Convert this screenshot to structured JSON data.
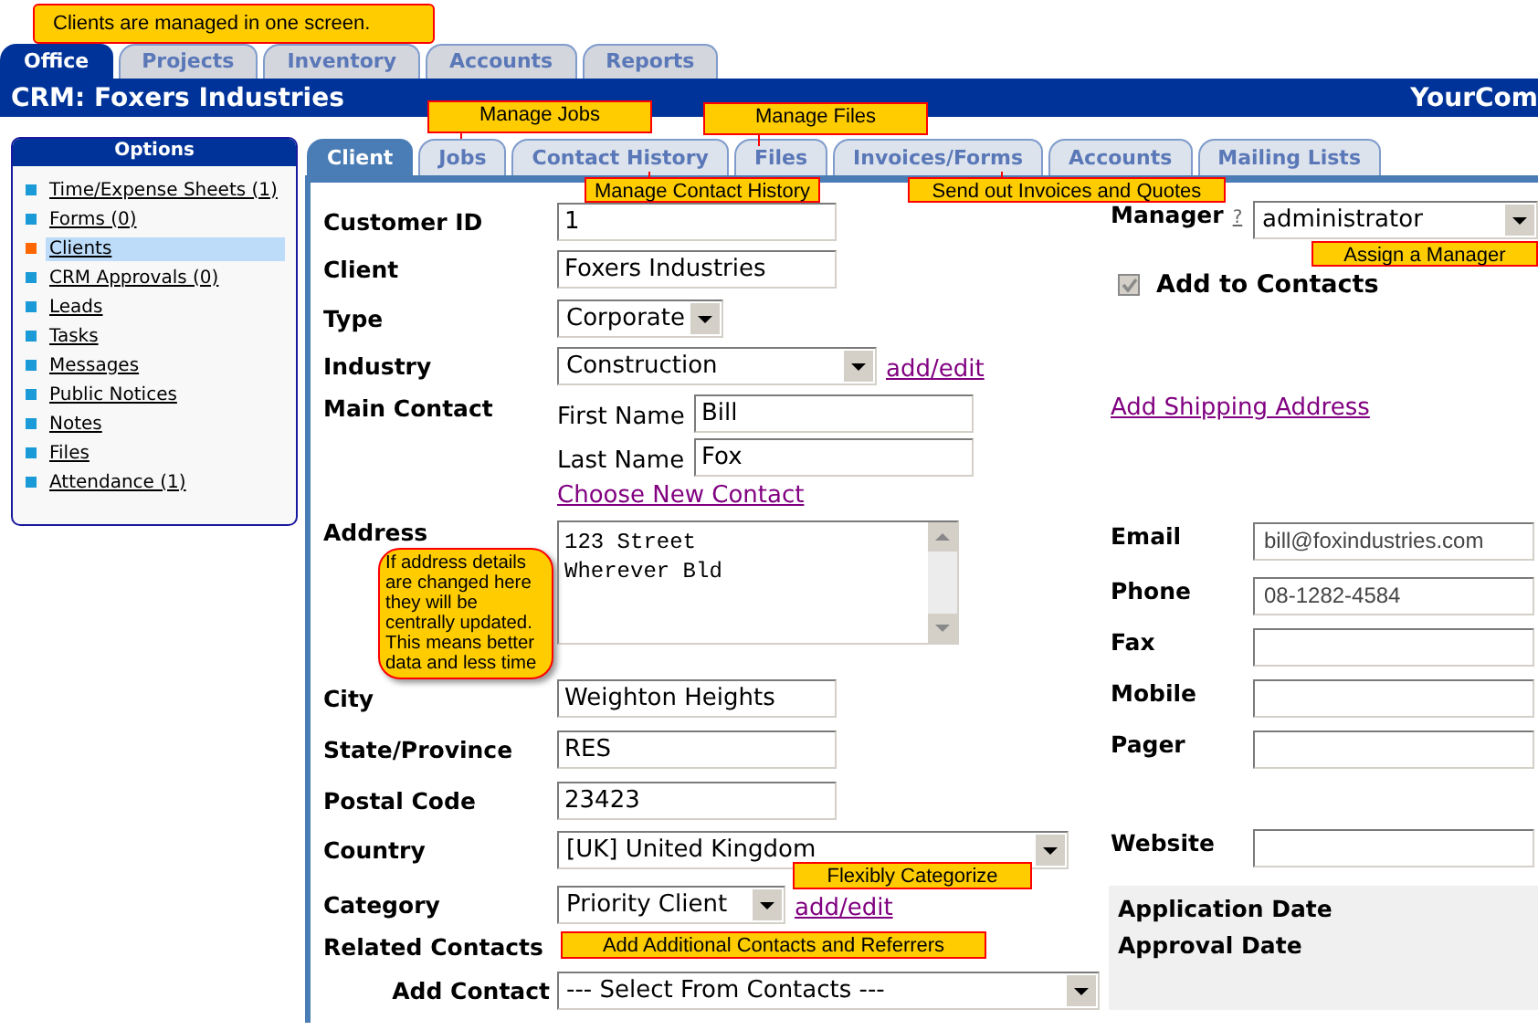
{
  "main_tabs": [
    {
      "label": "Office",
      "selected": true
    },
    {
      "label": "Projects",
      "selected": false
    },
    {
      "label": "Inventory",
      "selected": false
    },
    {
      "label": "Accounts",
      "selected": false
    },
    {
      "label": "Reports",
      "selected": false
    }
  ],
  "header": {
    "title": "CRM: Foxers Industries",
    "company": "YourCom"
  },
  "sidebar": {
    "title": "Options",
    "items": [
      {
        "label": "Time/Expense Sheets (1)",
        "selected": false,
        "color": "#1a9ad6"
      },
      {
        "label": "Forms (0)",
        "selected": false,
        "color": "#1a9ad6"
      },
      {
        "label": "Clients",
        "selected": true,
        "color": "#ff6600"
      },
      {
        "label": "CRM Approvals (0)",
        "selected": false,
        "color": "#1a9ad6"
      },
      {
        "label": "Leads",
        "selected": false,
        "color": "#1a9ad6"
      },
      {
        "label": "Tasks",
        "selected": false,
        "color": "#1a9ad6"
      },
      {
        "label": "Messages",
        "selected": false,
        "color": "#1a9ad6"
      },
      {
        "label": "Public Notices",
        "selected": false,
        "color": "#1a9ad6"
      },
      {
        "label": "Notes",
        "selected": false,
        "color": "#1a9ad6"
      },
      {
        "label": "Files",
        "selected": false,
        "color": "#1a9ad6"
      },
      {
        "label": "Attendance (1)",
        "selected": false,
        "color": "#1a9ad6"
      }
    ]
  },
  "sub_tabs": [
    {
      "label": "Client",
      "selected": true
    },
    {
      "label": "Jobs",
      "selected": false
    },
    {
      "label": "Contact History",
      "selected": false
    },
    {
      "label": "Files",
      "selected": false
    },
    {
      "label": "Invoices/Forms",
      "selected": false
    },
    {
      "label": "Accounts",
      "selected": false
    },
    {
      "label": "Mailing Lists",
      "selected": false
    }
  ],
  "form": {
    "left": [
      {
        "kind": "text",
        "label": "Customer ID",
        "value": "1"
      },
      {
        "kind": "text",
        "label": "Client",
        "value": "Foxers Industries"
      },
      {
        "kind": "select",
        "label": "Type",
        "value": "Corporate"
      },
      {
        "kind": "select",
        "label": "Industry",
        "value": "Construction",
        "link": "add/edit"
      },
      {
        "kind": "contact",
        "label": "Main Contact",
        "first_label": "First Name",
        "first": "Bill",
        "last_label": "Last Name",
        "last": "Fox",
        "link": "Choose New Contact"
      },
      {
        "kind": "textarea",
        "label": "Address",
        "value": "123 Street\nWherever Bld"
      },
      {
        "kind": "text",
        "label": "City",
        "value": "Weighton Heights"
      },
      {
        "kind": "text",
        "label": "State/Province",
        "value": "RES"
      },
      {
        "kind": "text",
        "label": "Postal Code",
        "value": "23423"
      },
      {
        "kind": "select",
        "label": "Country",
        "value": "[UK] United Kingdom"
      },
      {
        "kind": "select",
        "label": "Category",
        "value": "Priority Client",
        "link": "add/edit"
      },
      {
        "kind": "group",
        "label": "Related Contacts",
        "children": [
          {
            "kind": "select",
            "label": "Add Contact",
            "value": "--- Select From Contacts ---"
          }
        ]
      }
    ],
    "right": [
      {
        "kind": "select",
        "label": "Manager",
        "help": "?",
        "value": "administrator"
      },
      {
        "kind": "checkbox",
        "label": "Add to Contacts",
        "checked": true,
        "disabled": true
      },
      {
        "kind": "link",
        "label": "Add Shipping Address"
      },
      {
        "kind": "text",
        "label": "Email",
        "value": "bill@foxindustries.com"
      },
      {
        "kind": "text",
        "label": "Phone",
        "value": "08-1282-4584"
      },
      {
        "kind": "text",
        "label": "Fax"
      },
      {
        "kind": "text",
        "label": "Mobile"
      },
      {
        "kind": "text",
        "label": "Pager"
      },
      {
        "kind": "text",
        "label": "Website"
      },
      {
        "kind": "dates",
        "labels": [
          "Application Date",
          "Approval Date"
        ]
      }
    ]
  },
  "callouts": [
    {
      "kind": "tag",
      "text": "Clients are managed in one screen."
    },
    {
      "kind": "tag",
      "text": "Manage Jobs"
    },
    {
      "kind": "tag",
      "text": "Manage Files"
    },
    {
      "kind": "tag",
      "text": "Manage Contact History"
    },
    {
      "kind": "tag",
      "text": "Send out Invoices and Quotes"
    },
    {
      "kind": "tag",
      "text": "Assign a Manager"
    },
    {
      "kind": "bubble",
      "text": "If address details are changed here they will be centrally updated. This means better data and less time"
    },
    {
      "kind": "tag",
      "text": "Flexibly Categorize"
    },
    {
      "kind": "tag",
      "text": "Add Additional Contacts and Referrers"
    }
  ]
}
